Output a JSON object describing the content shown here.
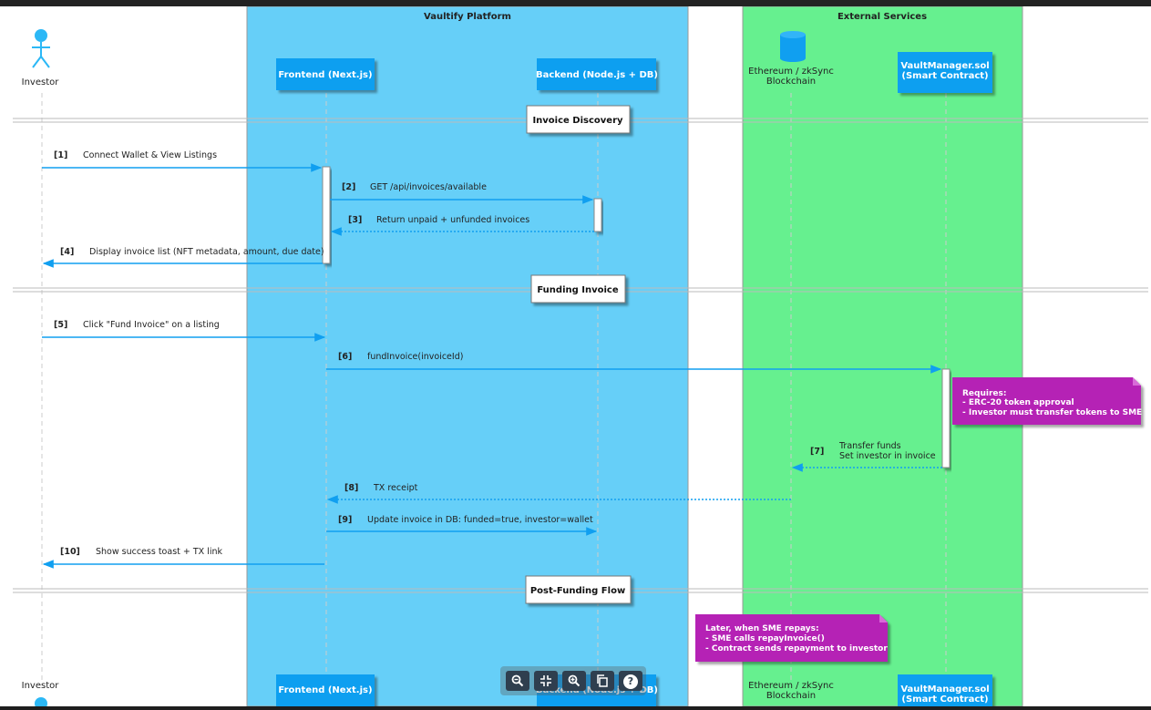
{
  "groups": {
    "platform": "Vaultify Platform",
    "external": "External Services"
  },
  "participants": {
    "investor": "Investor",
    "frontend": "Frontend (Next.js)",
    "backend": "Backend (Node.js + DB)",
    "chain_line1": "Ethereum / zkSync",
    "chain_line2": "Blockchain",
    "contract_line1": "VaultManager.sol",
    "contract_line2": "(Smart Contract)"
  },
  "sections": {
    "discovery": "Invoice Discovery",
    "funding": "Funding Invoice",
    "post": "Post-Funding Flow"
  },
  "messages": {
    "m1_num": "[1]",
    "m1": "Connect Wallet & View Listings",
    "m2_num": "[2]",
    "m2": "GET /api/invoices/available",
    "m3_num": "[3]",
    "m3": "Return unpaid + unfunded invoices",
    "m4_num": "[4]",
    "m4": "Display invoice list (NFT metadata, amount, due date)",
    "m5_num": "[5]",
    "m5": "Click \"Fund Invoice\" on a listing",
    "m6_num": "[6]",
    "m6": "fundInvoice(invoiceId)",
    "m7_num": "[7]",
    "m7_line1": "Transfer funds",
    "m7_line2": "Set investor in invoice",
    "m8_num": "[8]",
    "m8": "TX receipt",
    "m9_num": "[9]",
    "m9": "Update invoice in DB: funded=true, investor=wallet",
    "m10_num": "[10]",
    "m10": "Show success toast + TX link"
  },
  "notes": {
    "requires_line1": "Requires:",
    "requires_line2": "- ERC-20 token approval",
    "requires_line3": "- Investor must transfer tokens to SME",
    "later_line1": "Later, when SME repays:",
    "later_line2": "- SME calls repayInvoice()",
    "later_line3": "- Contract sends repayment to investor"
  },
  "toolbar": {
    "zoom_in_icon": "zoom-in-icon",
    "fit_icon": "fit-screen-icon",
    "zoom_out_icon": "zoom-out-icon",
    "copy_icon": "copy-icon",
    "help_icon": "help-icon",
    "help_label": "?"
  },
  "colors": {
    "platform_bg": "#66cff8",
    "external_bg": "#66f08f",
    "participant": "#109ff0",
    "arrow": "#109ff0",
    "note": "#b521b5",
    "actor": "#2cb8f6"
  }
}
